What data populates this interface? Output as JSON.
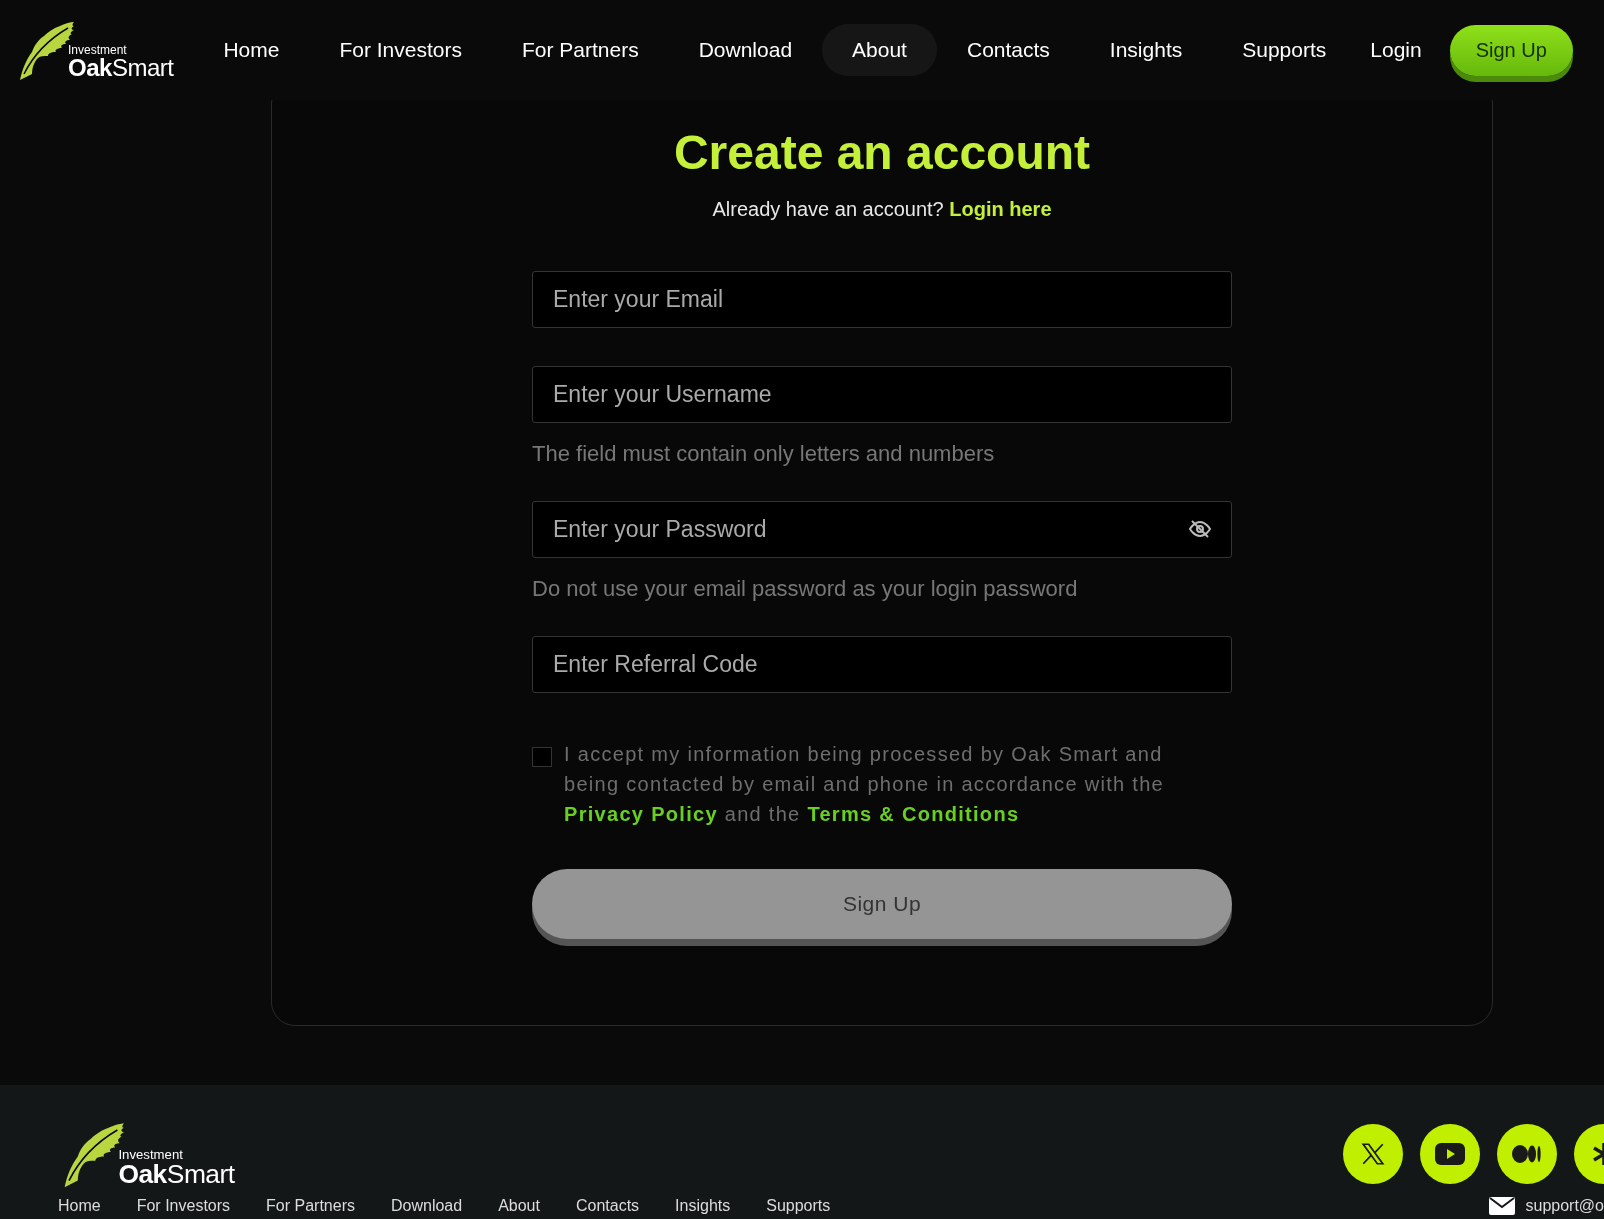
{
  "header": {
    "logo": {
      "tagline": "Investment",
      "name": "**Oak**Smart"
    },
    "nav": [
      {
        "label": "Home",
        "selected": false
      },
      {
        "label": "For Investors",
        "selected": false
      },
      {
        "label": "For Partners",
        "selected": false
      },
      {
        "label": "Download",
        "selected": false
      },
      {
        "label": "About",
        "selected": true
      },
      {
        "label": "Contacts",
        "selected": false
      },
      {
        "label": "Insights",
        "selected": false
      },
      {
        "label": "Supports",
        "selected": false
      }
    ],
    "login": "Login",
    "signup": "Sign Up"
  },
  "form": {
    "title": "Create an account",
    "prompt": "Already have an account?",
    "login_link": "Login here",
    "fields": [
      {
        "kind": "text",
        "placeholder": "Enter your Email"
      },
      {
        "kind": "text",
        "placeholder": "Enter your Username",
        "hint": "The field must contain only letters and numbers"
      },
      {
        "kind": "password",
        "placeholder": "Enter your Password",
        "hint": "Do not use your email password as your login password"
      },
      {
        "kind": "text",
        "placeholder": "Enter Referral Code"
      }
    ],
    "consent": {
      "checked": false,
      "text": "I accept my information being processed by Oak Smart and being contacted by email and phone in accordance with the",
      "privacy": "Privacy Policy",
      "joiner": "and the",
      "terms": "Terms & Conditions"
    },
    "submit": {
      "label": "Sign Up",
      "disabled": true
    }
  },
  "footer": {
    "logo": {
      "tagline": "Investment",
      "name": "**Oak**Smart"
    },
    "social": [
      {
        "kind": "x"
      },
      {
        "kind": "youtube"
      },
      {
        "kind": "medium"
      },
      {
        "kind": "asterisk"
      }
    ],
    "links": [
      "Home",
      "For Investors",
      "For Partners",
      "Download",
      "About",
      "Contacts",
      "Insights",
      "Supports"
    ],
    "email": "support@o"
  }
}
